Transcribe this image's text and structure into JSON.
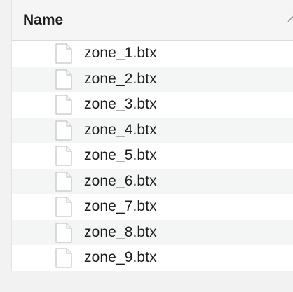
{
  "header": {
    "name_label": "Name"
  },
  "files": [
    {
      "name": "zone_1.btx"
    },
    {
      "name": "zone_2.btx"
    },
    {
      "name": "zone_3.btx"
    },
    {
      "name": "zone_4.btx"
    },
    {
      "name": "zone_5.btx"
    },
    {
      "name": "zone_6.btx"
    },
    {
      "name": "zone_7.btx"
    },
    {
      "name": "zone_8.btx"
    },
    {
      "name": "zone_9.btx"
    }
  ],
  "icons": {
    "file": "document-icon",
    "sort": "sort-ascending-icon"
  }
}
